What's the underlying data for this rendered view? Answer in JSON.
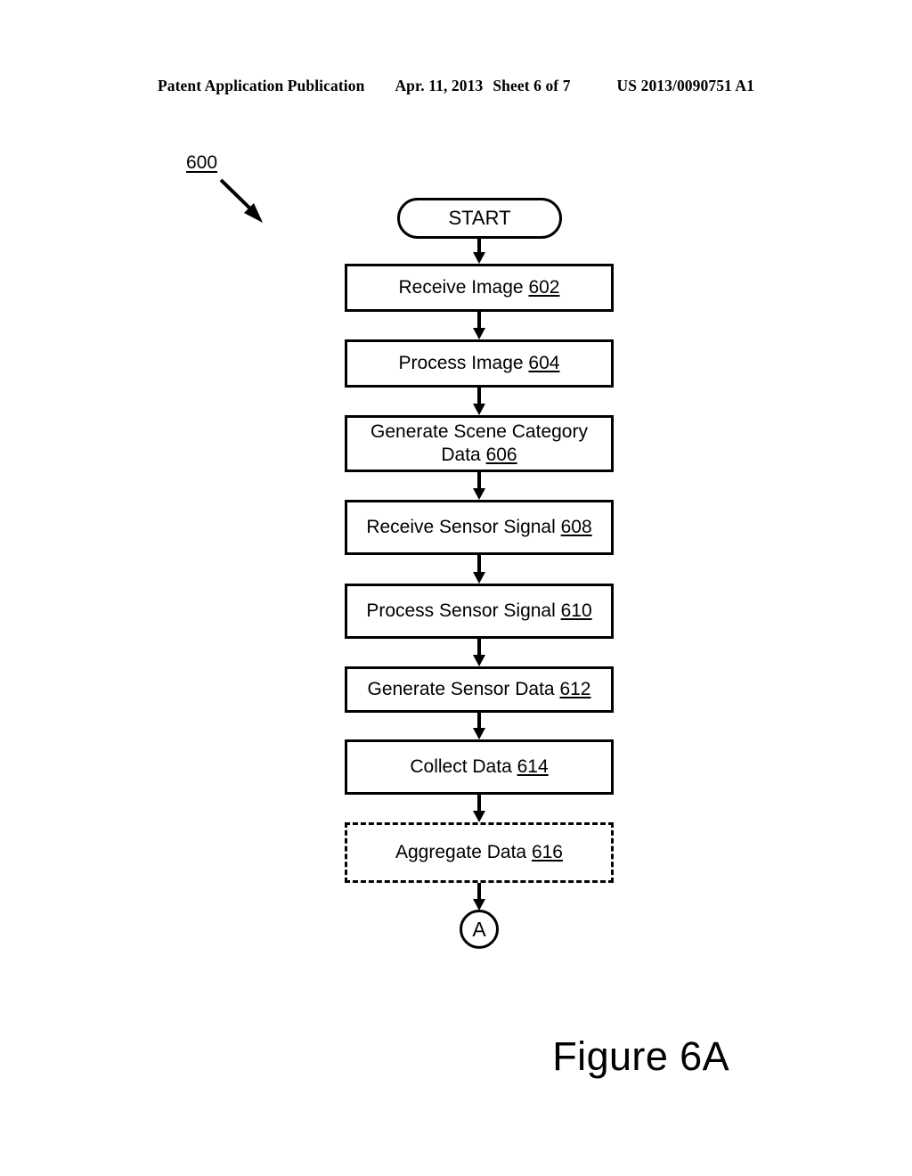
{
  "header": {
    "publication": "Patent Application Publication",
    "date": "Apr. 11, 2013",
    "sheet": "Sheet 6 of 7",
    "patent_number": "US 2013/0090751 A1"
  },
  "figure": {
    "reference_numeral": "600",
    "caption": "Figure 6A",
    "type": "flowchart",
    "line_color": "#000000",
    "background_color": "#ffffff"
  },
  "flowchart": {
    "start": {
      "label": "START",
      "shape": "terminator"
    },
    "steps": [
      {
        "text": "Receive Image",
        "num": "602",
        "shape": "process",
        "border": "solid"
      },
      {
        "text": "Process Image",
        "num": "604",
        "shape": "process",
        "border": "solid"
      },
      {
        "text": "Generate Scene Category Data",
        "num": "606",
        "shape": "process",
        "border": "solid"
      },
      {
        "text": "Receive Sensor Signal",
        "num": "608",
        "shape": "process",
        "border": "solid"
      },
      {
        "text": "Process Sensor Signal",
        "num": "610",
        "shape": "process",
        "border": "solid"
      },
      {
        "text": "Generate Sensor Data",
        "num": "612",
        "shape": "process",
        "border": "solid"
      },
      {
        "text": "Collect Data",
        "num": "614",
        "shape": "process",
        "border": "solid"
      },
      {
        "text": "Aggregate Data",
        "num": "616",
        "shape": "process",
        "border": "dashed"
      }
    ],
    "connector": {
      "label": "A",
      "shape": "circle"
    }
  }
}
